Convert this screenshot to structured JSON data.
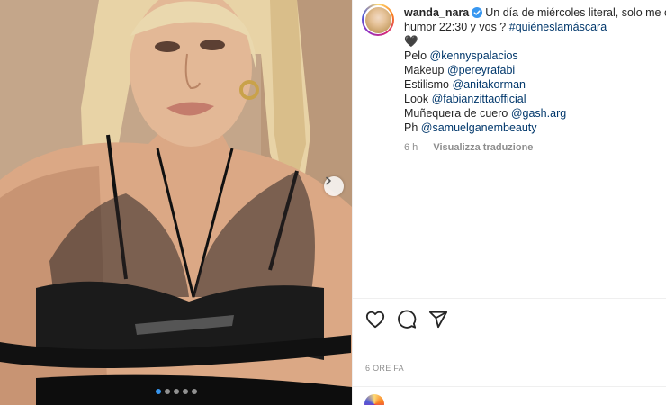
{
  "post": {
    "carousel": {
      "slide_count": 5,
      "active_index": 0
    },
    "author": {
      "username": "wanda_nara",
      "verified": true
    },
    "caption_lines": [
      "Un día de miércoles literal, solo me ca",
      "humor 22:30 y vos ?",
      "#quiéneslamáscara"
    ],
    "heart_emoji": "🖤",
    "credits": [
      {
        "label": "Pelo",
        "handle": "@kennyspalacios"
      },
      {
        "label": "Makeup",
        "handle": "@pereyrafabi"
      },
      {
        "label": "Estilismo",
        "handle": "@anitakorman"
      },
      {
        "label": "Look",
        "handle": "@fabianzittaofficial"
      },
      {
        "label": "Muñequera de cuero",
        "handle": "@gash.arg"
      },
      {
        "label": "Ph",
        "handle": "@samuelganembeauty"
      }
    ],
    "comment_time": "6 h",
    "translate_label": "Visualizza traduzione",
    "post_time": "6 ORE FA"
  },
  "icons": {
    "next": "chevron-right-icon",
    "like": "heart-outline-icon",
    "comment": "comment-bubble-icon",
    "share": "paper-plane-icon",
    "verified": "verified-badge-icon"
  },
  "colors": {
    "link": "#00376b",
    "verified": "#3897f0",
    "muted": "#8e8e8e",
    "text": "#262626"
  }
}
